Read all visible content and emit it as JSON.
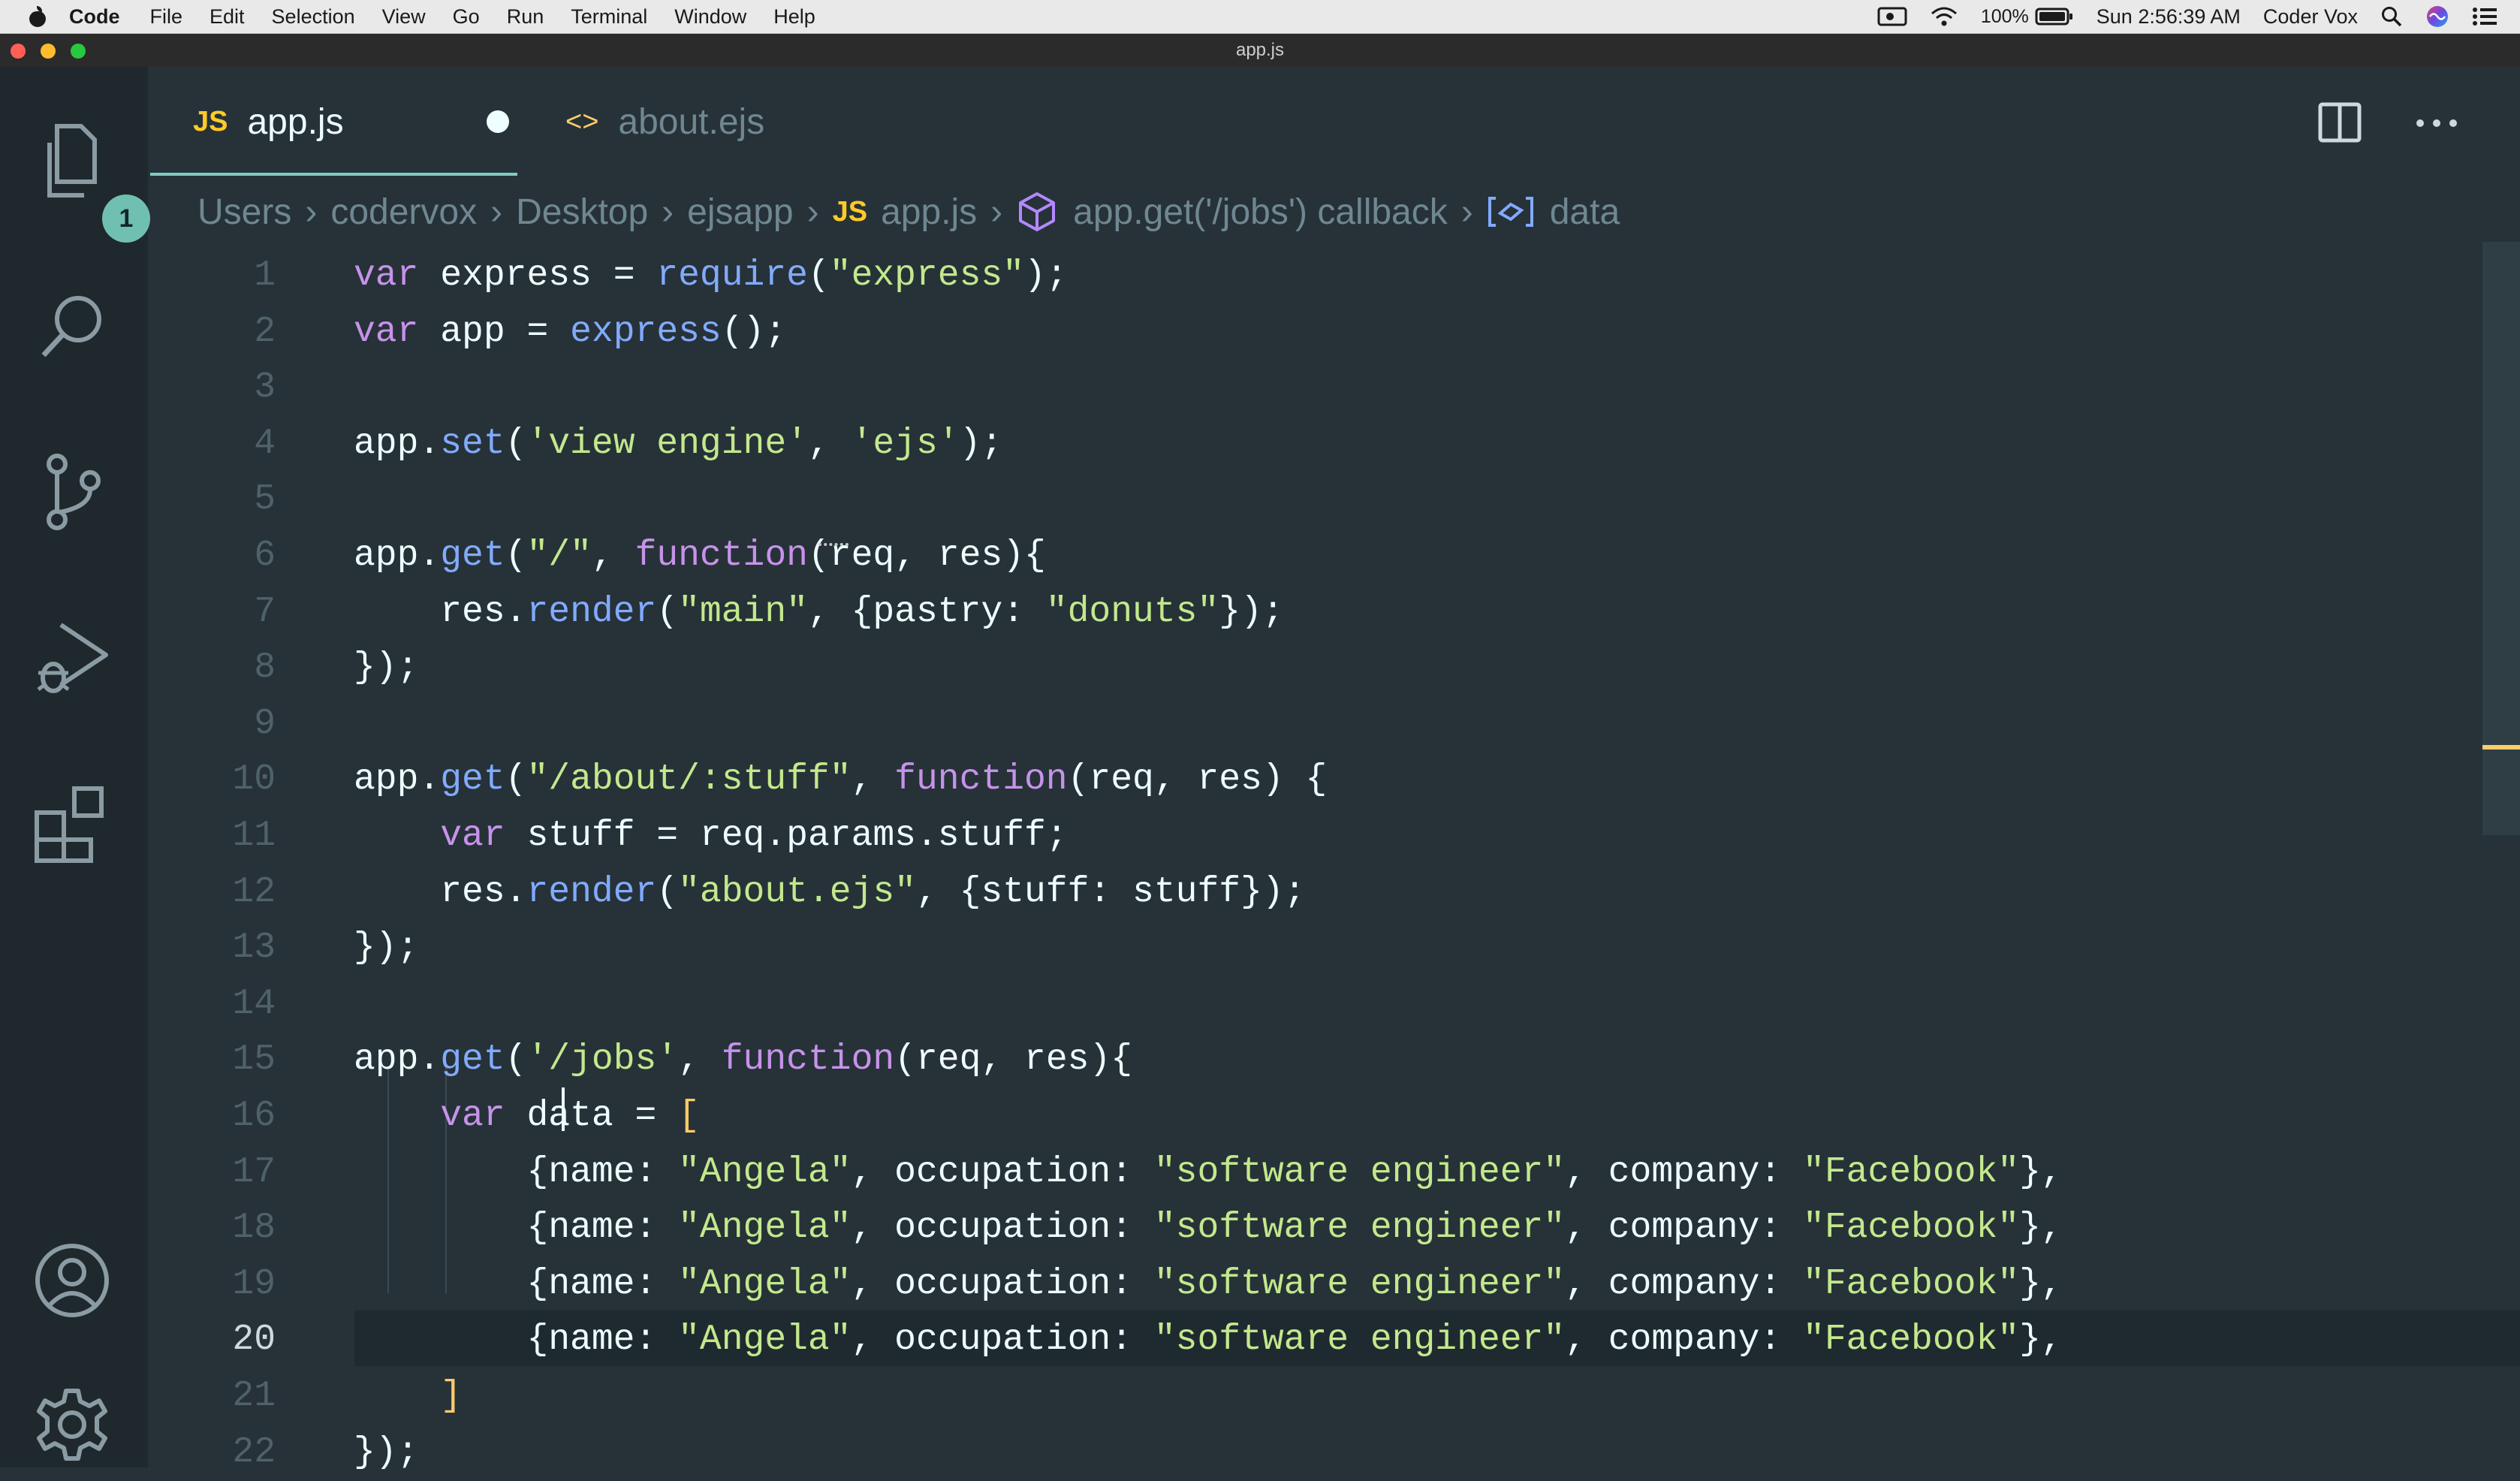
{
  "menubar": {
    "app": "Code",
    "items": [
      "File",
      "Edit",
      "Selection",
      "View",
      "Go",
      "Run",
      "Terminal",
      "Window",
      "Help"
    ],
    "battery": "100%",
    "clock": "Sun 2:56:39 AM",
    "user": "Coder Vox"
  },
  "window": {
    "title": "app.js"
  },
  "activity": {
    "explorer_badge": "1"
  },
  "tabs": [
    {
      "icon": "JS",
      "label": "app.js",
      "dirty": true,
      "active": true
    },
    {
      "icon": "<>",
      "label": "about.ejs",
      "dirty": false,
      "active": false
    }
  ],
  "breadcrumb": {
    "items": [
      "Users",
      "codervox",
      "Desktop",
      "ejsapp"
    ],
    "file_icon": "JS",
    "file": "app.js",
    "callback": "app.get('/jobs') callback",
    "symbol": "data"
  },
  "editor": {
    "lines": [
      {
        "n": "1",
        "text": "var express = require(\"express\");"
      },
      {
        "n": "2",
        "text": "var app = express();"
      },
      {
        "n": "3",
        "text": ""
      },
      {
        "n": "4",
        "text": "app.set('view engine', 'ejs');"
      },
      {
        "n": "5",
        "text": ""
      },
      {
        "n": "6",
        "text": "app.get(\"/\", function(req, res){"
      },
      {
        "n": "7",
        "text": "    res.render(\"main\", {pastry: \"donuts\"});"
      },
      {
        "n": "8",
        "text": "});"
      },
      {
        "n": "9",
        "text": ""
      },
      {
        "n": "10",
        "text": "app.get(\"/about/:stuff\", function(req, res) {"
      },
      {
        "n": "11",
        "text": "    var stuff = req.params.stuff;"
      },
      {
        "n": "12",
        "text": "    res.render(\"about.ejs\", {stuff: stuff});"
      },
      {
        "n": "13",
        "text": "});"
      },
      {
        "n": "14",
        "text": ""
      },
      {
        "n": "15",
        "text": "app.get('/jobs', function(req, res){"
      },
      {
        "n": "16",
        "text": "    var data = ["
      },
      {
        "n": "17",
        "text": "        {name: \"Angela\", occupation: \"software engineer\", company: \"Facebook\"},"
      },
      {
        "n": "18",
        "text": "        {name: \"Angela\", occupation: \"software engineer\", company: \"Facebook\"},"
      },
      {
        "n": "19",
        "text": "        {name: \"Angela\", occupation: \"software engineer\", company: \"Facebook\"},"
      },
      {
        "n": "20",
        "text": "        {name: \"Angela\", occupation: \"software engineer\", company: \"Facebook\"},"
      },
      {
        "n": "21",
        "text": "    ]"
      },
      {
        "n": "22",
        "text": "});"
      }
    ],
    "current_line": "20"
  },
  "colors": {
    "background": "#263238",
    "activity_bar": "#1f282d",
    "keyword": "#c792ea",
    "function": "#82aaff",
    "string": "#c3e88d",
    "bracket": "#ffcb6b",
    "accent": "#80cbc4"
  }
}
